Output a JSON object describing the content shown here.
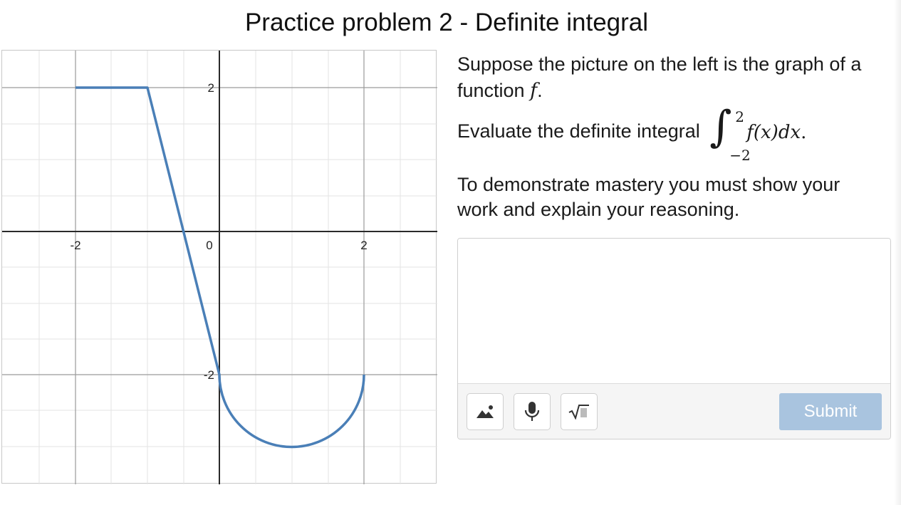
{
  "title": "Practice problem 2 - Definite integral",
  "graph": {
    "x_ticks": [
      "-2",
      "0",
      "2"
    ],
    "y_ticks": [
      "2",
      "-2"
    ],
    "curve_color": "#4a7fb7"
  },
  "prompt": {
    "p1": "Suppose the picture on the left is the graph of a function",
    "p1_fn": "f",
    "p1_end": ".",
    "p2_lead": "Evaluate the definite integral",
    "integral_upper": "2",
    "integral_lower": "−2",
    "integral_body": "f(x)dx",
    "integral_end": ".",
    "p3": "To demonstrate mastery you must show your work and explain your reasoning."
  },
  "answer": {
    "placeholder": "",
    "tools": [
      "image-icon",
      "microphone-icon",
      "square-root-icon"
    ],
    "submit_label": "Submit",
    "submit_color": "#a9c4df"
  }
}
